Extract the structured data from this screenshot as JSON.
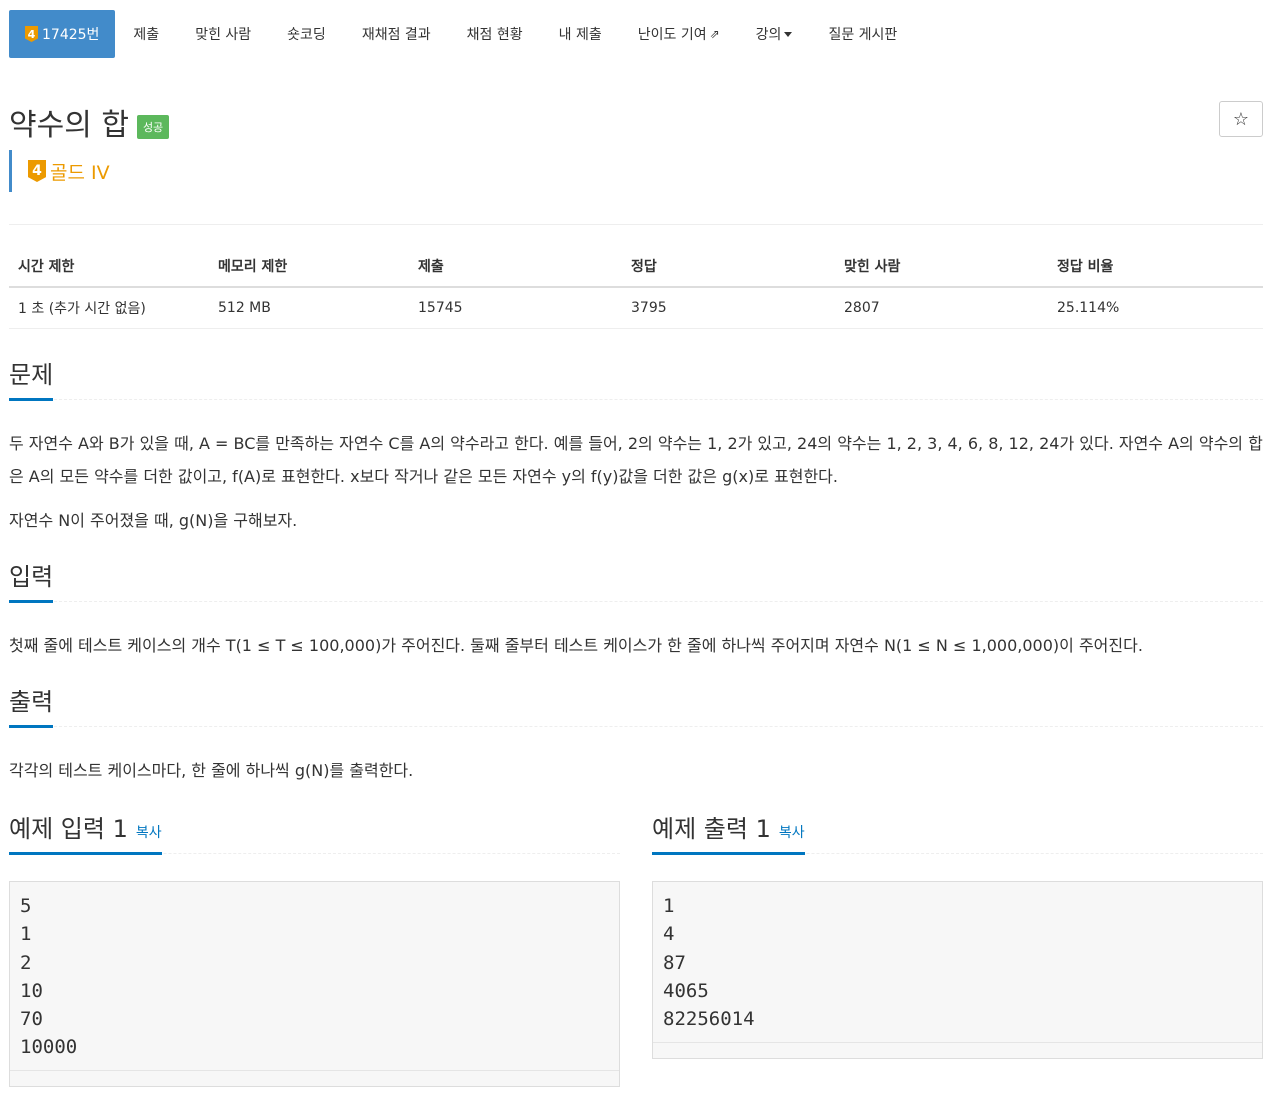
{
  "nav": {
    "problem": {
      "tier_badge": "4",
      "label": "17425번"
    },
    "items": [
      "제출",
      "맞힌 사람",
      "숏코딩",
      "재채점 결과",
      "채점 현황",
      "내 제출",
      "난이도 기여",
      "강의",
      "질문 게시판"
    ]
  },
  "title": "약수의 합",
  "result_badge": "성공",
  "tier": {
    "badge": "4",
    "label": "골드 IV",
    "color": "#ec9a00"
  },
  "stats": {
    "headers": [
      "시간 제한",
      "메모리 제한",
      "제출",
      "정답",
      "맞힌 사람",
      "정답 비율"
    ],
    "values": [
      "1 초 (추가 시간 없음)",
      "512 MB",
      "15745",
      "3795",
      "2807",
      "25.114%"
    ]
  },
  "sections": {
    "problem": {
      "title": "문제",
      "paragraphs": [
        "두 자연수 A와 B가 있을 때, A = BC를 만족하는 자연수 C를 A의 약수라고 한다. 예를 들어, 2의 약수는 1, 2가 있고, 24의 약수는 1, 2, 3, 4, 6, 8, 12, 24가 있다. 자연수 A의 약수의 합은 A의 모든 약수를 더한 값이고, f(A)로 표현한다. x보다 작거나 같은 모든 자연수 y의 f(y)값을 더한 값은 g(x)로 표현한다.",
        "자연수 N이 주어졌을 때, g(N)을 구해보자."
      ]
    },
    "input": {
      "title": "입력",
      "text": "첫째 줄에 테스트 케이스의 개수 T(1 ≤ T ≤ 100,000)가 주어진다. 둘째 줄부터 테스트 케이스가 한 줄에 하나씩 주어지며 자연수 N(1 ≤ N ≤ 1,000,000)이 주어진다."
    },
    "output": {
      "title": "출력",
      "text": "각각의 테스트 케이스마다, 한 줄에 하나씩 g(N)를 출력한다."
    }
  },
  "samples": {
    "input": {
      "title": "예제 입력 1",
      "copy_label": "복사",
      "lines": [
        "5",
        "1",
        "2",
        "10",
        "70",
        "10000"
      ]
    },
    "output": {
      "title": "예제 출력 1",
      "copy_label": "복사",
      "lines": [
        "1",
        "4",
        "87",
        "4065",
        "82256014"
      ]
    }
  },
  "colors": {
    "accent": "#428bca",
    "link": "#0076c0",
    "success": "#5cb85c",
    "gold": "#ec9a00"
  }
}
